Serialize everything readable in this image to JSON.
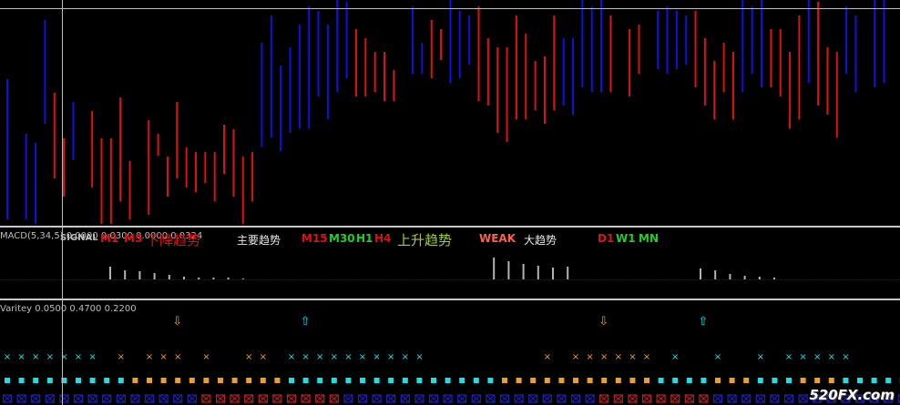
{
  "colors": {
    "background": "#000000",
    "bull": "#1010e0",
    "bear": "#e01010",
    "separator": "#c8c8c8",
    "label": "#bdbdbd",
    "histogram": "#b4b4b4",
    "dots_zero": "#5a1010",
    "cyan": "#18e0e8",
    "orange": "#f0a020",
    "box_blue": "#2020c0",
    "box_red": "#c02020",
    "green": "#20d020",
    "yellow_green": "#a0d020",
    "weak": "#ff6040",
    "white": "#e8e8e8"
  },
  "macd_pane": {
    "label": "MACD(5,34,5) 0.0000 0.0300 0.0000 0.0324",
    "signal_word": "SIGNAL",
    "signals": [
      {
        "text": "M1",
        "color": "#e01010",
        "style": "bold"
      },
      {
        "text": "M5",
        "color": "#e01010",
        "style": "bold"
      },
      {
        "text": "下降趋势",
        "color": "#e01010",
        "style": "big"
      },
      {
        "text": "主要趋势",
        "color": "#e8e8e8",
        "style": "normal"
      },
      {
        "text": "M15",
        "color": "#e01010",
        "style": "bold"
      },
      {
        "text": "M30",
        "color": "#20d020",
        "style": "bold"
      },
      {
        "text": "H1",
        "color": "#20d020",
        "style": "bold"
      },
      {
        "text": "H4",
        "color": "#e01010",
        "style": "bold"
      },
      {
        "text": "上升趋势",
        "color": "#a0d020",
        "style": "big"
      },
      {
        "text": "WEAK",
        "color": "#ff6040",
        "style": "bold"
      },
      {
        "text": "大趋势",
        "color": "#e8e8e8",
        "style": "normal"
      },
      {
        "text": "D1",
        "color": "#e01010",
        "style": "bold"
      },
      {
        "text": "W1",
        "color": "#20d020",
        "style": "bold"
      },
      {
        "text": "MN",
        "color": "#20d020",
        "style": "bold"
      }
    ],
    "histogram": [
      14,
      10,
      9,
      7,
      5,
      3,
      2,
      2,
      2,
      1,
      0,
      0,
      0,
      0,
      0,
      0,
      0,
      0,
      0,
      0,
      0,
      0,
      0,
      0,
      0,
      0,
      24,
      20,
      17,
      15,
      13,
      14,
      0,
      0,
      0,
      0,
      0,
      0,
      0,
      0,
      12,
      10,
      6,
      4,
      3,
      2,
      0,
      0,
      0,
      0,
      0,
      0,
      0,
      0,
      0,
      0,
      0,
      0,
      7
    ]
  },
  "varitey_pane": {
    "label": "Varitey 0.0500 0.4700 0.2200",
    "arrows": [
      {
        "symbol": "⇩",
        "color": "#f0a020",
        "at": 12
      },
      {
        "symbol": "⇧",
        "color": "#18e0e8",
        "at": 21
      },
      {
        "symbol": "⇩",
        "color": "#f0a020",
        "at": 42
      },
      {
        "symbol": "⇧",
        "color": "#18e0e8",
        "at": 49
      }
    ],
    "crosses": "ccccccc.o.ooo.o..oo.cccccccccc........o.oooooo.c..c..c.ccccc",
    "squares": "cccccccccooooooooooocccccccccccccccoooooooooooccccooocccooocccccc",
    "boxes": "bbbbbbbbbbbbbbrrrrrrrrrrbbbbbbbbbbbbbbbbbbrrrrrrrrbbbbbbbbbbbbbb"
  },
  "price_pane": {
    "candles": [
      [
        120,
        70
      ],
      [
        0,
        0
      ],
      [
        150,
        40
      ],
      [
        180,
        60
      ],
      [
        35,
        50
      ],
      [
        105,
        -40
      ],
      [
        140,
        -25
      ],
      [
        100,
        25
      ],
      [
        0,
        0
      ],
      [
        120,
        -35
      ],
      [
        160,
        -45
      ],
      [
        155,
        -40
      ],
      [
        120,
        -50
      ],
      [
        165,
        -25
      ],
      [
        0,
        0
      ],
      [
        140,
        -45
      ],
      [
        115,
        -5
      ],
      [
        150,
        -15
      ],
      [
        110,
        -35
      ],
      [
        140,
        -15
      ],
      [
        145,
        -15
      ],
      [
        140,
        -10
      ],
      [
        150,
        -20
      ],
      [
        120,
        -20
      ],
      [
        135,
        -30
      ],
      [
        170,
        -35
      ],
      [
        150,
        -20
      ],
      [
        60,
        50
      ],
      [
        40,
        60
      ],
      [
        75,
        40
      ],
      [
        55,
        40
      ],
      [
        40,
        50
      ],
      [
        30,
        60
      ],
      [
        15,
        40
      ],
      [
        35,
        45
      ],
      [
        0,
        50
      ],
      [
        0,
        35
      ],
      [
        25,
        -30
      ],
      [
        30,
        -25
      ],
      [
        35,
        -15
      ],
      [
        40,
        -20
      ],
      [
        50,
        -10
      ],
      [
        0,
        0
      ],
      [
        0,
        30
      ],
      [
        20,
        10
      ],
      [
        10,
        -25
      ],
      [
        5,
        -10
      ],
      [
        0,
        40
      ],
      [
        5,
        30
      ],
      [
        0,
        20
      ],
      [
        15,
        -45
      ],
      [
        35,
        -30
      ],
      [
        55,
        -40
      ],
      [
        60,
        -45
      ],
      [
        30,
        -50
      ],
      [
        40,
        -40
      ],
      [
        50,
        -20
      ],
      [
        55,
        -30
      ],
      [
        25,
        -45
      ],
      [
        35,
        30
      ],
      [
        40,
        35
      ],
      [
        0,
        45
      ],
      [
        10,
        40
      ],
      [
        0,
        50
      ],
      [
        15,
        -35
      ],
      [
        0,
        0
      ],
      [
        25,
        -30
      ],
      [
        10,
        -20
      ],
      [
        0,
        0
      ],
      [
        0,
        25
      ],
      [
        0,
        30
      ],
      [
        0,
        25
      ],
      [
        0,
        20
      ],
      [
        10,
        -35
      ],
      [
        35,
        -30
      ],
      [
        55,
        -25
      ],
      [
        30,
        -20
      ],
      [
        50,
        -30
      ],
      [
        0,
        50
      ],
      [
        0,
        30
      ],
      [
        0,
        45
      ],
      [
        20,
        -25
      ],
      [
        25,
        -30
      ],
      [
        55,
        -35
      ],
      [
        30,
        -50
      ],
      [
        0,
        40
      ],
      [
        15,
        -50
      ],
      [
        45,
        -30
      ],
      [
        60,
        -40
      ],
      [
        0,
        30
      ],
      [
        15,
        35
      ],
      [
        0,
        0
      ],
      [
        0,
        45
      ],
      [
        0,
        40
      ]
    ]
  },
  "watermark": "520FX.com"
}
